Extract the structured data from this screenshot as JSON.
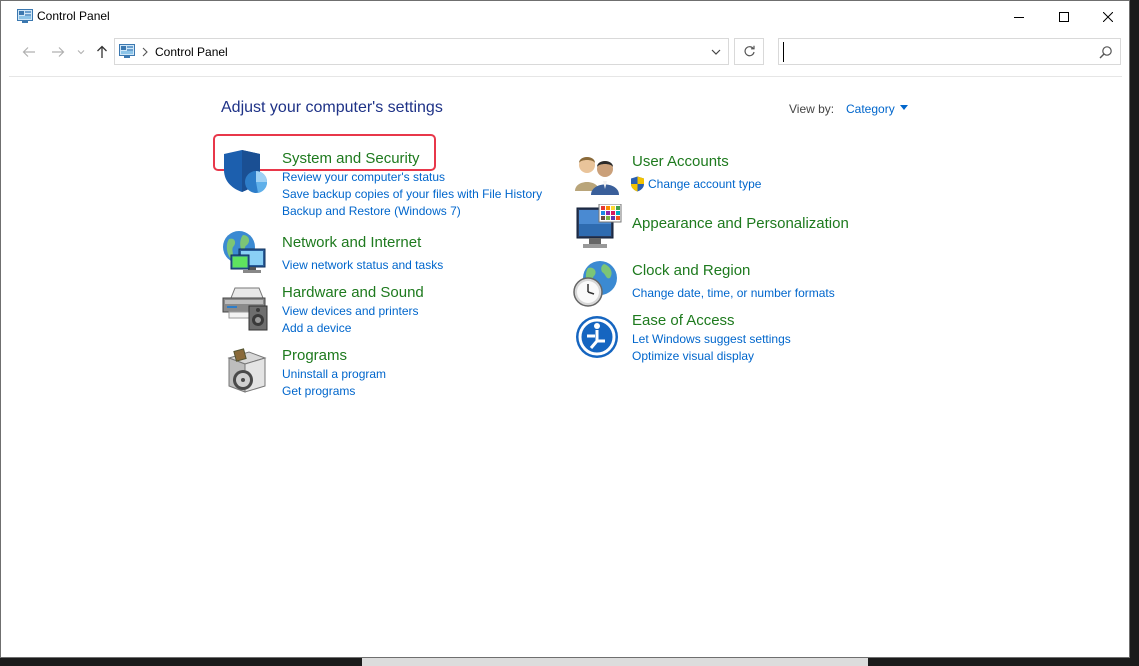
{
  "window": {
    "title": "Control Panel"
  },
  "navbar": {
    "address_path": "Control Panel",
    "search_placeholder": ""
  },
  "content": {
    "heading": "Adjust your computer's settings",
    "view_by_label": "View by:",
    "view_by_value": "Category"
  },
  "categories": {
    "system_security": {
      "title": "System and Security",
      "links": [
        "Review your computer's status",
        "Save backup copies of your files with File History",
        "Backup and Restore (Windows 7)"
      ]
    },
    "network": {
      "title": "Network and Internet",
      "links": [
        "View network status and tasks"
      ]
    },
    "hardware": {
      "title": "Hardware and Sound",
      "links": [
        "View devices and printers",
        "Add a device"
      ]
    },
    "programs": {
      "title": "Programs",
      "links": [
        "Uninstall a program",
        "Get programs"
      ]
    },
    "user_accounts": {
      "title": "User Accounts",
      "links": [
        "Change account type"
      ]
    },
    "appearance": {
      "title": "Appearance and Personalization",
      "links": []
    },
    "clock": {
      "title": "Clock and Region",
      "links": [
        "Change date, time, or number formats"
      ]
    },
    "ease": {
      "title": "Ease of Access",
      "links": [
        "Let Windows suggest settings",
        "Optimize visual display"
      ]
    }
  },
  "icons": {
    "app": "control-panel-icon",
    "back": "back-arrow-icon",
    "forward": "forward-arrow-icon",
    "up": "up-arrow-icon",
    "refresh": "refresh-icon",
    "search": "search-icon"
  },
  "colors": {
    "heading": "#1e3287",
    "category_title": "#1e7a1e",
    "link": "#0066cc",
    "highlight": "#e8374a"
  }
}
